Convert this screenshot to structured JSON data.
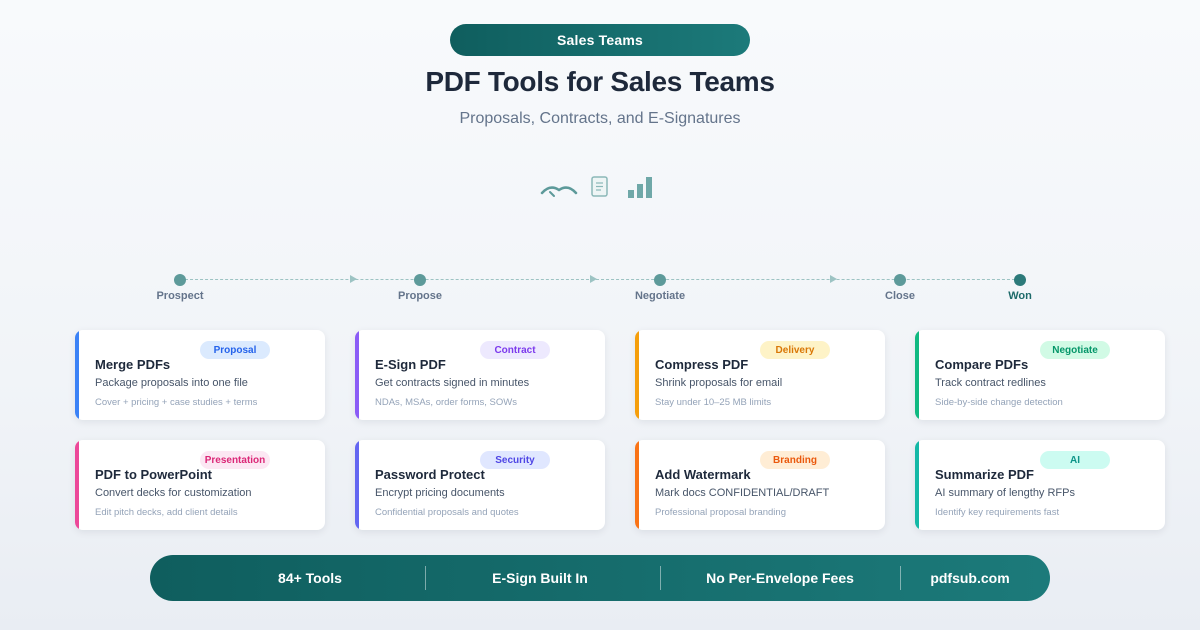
{
  "header": {
    "tag": "Sales Teams",
    "title": "PDF Tools for Sales Teams",
    "subtitle": "Proposals, Contracts, and E-Signatures"
  },
  "hero_icons": [
    "handshake-icon",
    "document-icon",
    "bar-chart-icon"
  ],
  "pipeline": {
    "stages": [
      "Prospect",
      "Propose",
      "Negotiate",
      "Close",
      "Won"
    ]
  },
  "cards": [
    {
      "title": "Merge PDFs",
      "badge": "Proposal",
      "desc": "Package proposals into one file",
      "note": "Cover + pricing + case studies + terms",
      "accent": "#3b82f6",
      "badge_bg": "#dbeafe",
      "badge_fg": "#2563eb"
    },
    {
      "title": "E-Sign PDF",
      "badge": "Contract",
      "desc": "Get contracts signed in minutes",
      "note": "NDAs, MSAs, order forms, SOWs",
      "accent": "#8b5cf6",
      "badge_bg": "#ede9fe",
      "badge_fg": "#7c3aed"
    },
    {
      "title": "Compress PDF",
      "badge": "Delivery",
      "desc": "Shrink proposals for email",
      "note": "Stay under 10–25 MB limits",
      "accent": "#f59e0b",
      "badge_bg": "#fef3c7",
      "badge_fg": "#d97706"
    },
    {
      "title": "Compare PDFs",
      "badge": "Negotiate",
      "desc": "Track contract redlines",
      "note": "Side-by-side change detection",
      "accent": "#10b981",
      "badge_bg": "#d1fae5",
      "badge_fg": "#059669"
    },
    {
      "title": "PDF to PowerPoint",
      "badge": "Presentation",
      "desc": "Convert decks for customization",
      "note": "Edit pitch decks, add client details",
      "accent": "#ec4899",
      "badge_bg": "#fce7f3",
      "badge_fg": "#db2777"
    },
    {
      "title": "Password Protect",
      "badge": "Security",
      "desc": "Encrypt pricing documents",
      "note": "Confidential proposals and quotes",
      "accent": "#6366f1",
      "badge_bg": "#e0e7ff",
      "badge_fg": "#4f46e5"
    },
    {
      "title": "Add Watermark",
      "badge": "Branding",
      "desc": "Mark docs CONFIDENTIAL/DRAFT",
      "note": "Professional proposal branding",
      "accent": "#f97316",
      "badge_bg": "#ffedd5",
      "badge_fg": "#ea580c"
    },
    {
      "title": "Summarize PDF",
      "badge": "AI",
      "desc": "AI summary of lengthy RFPs",
      "note": "Identify key requirements fast",
      "accent": "#14b8a6",
      "badge_bg": "#ccfbf1",
      "badge_fg": "#0d9488"
    }
  ],
  "footer": {
    "items": [
      "84+ Tools",
      "E-Sign Built In",
      "No Per-Envelope Fees",
      "pdfsub.com"
    ]
  }
}
